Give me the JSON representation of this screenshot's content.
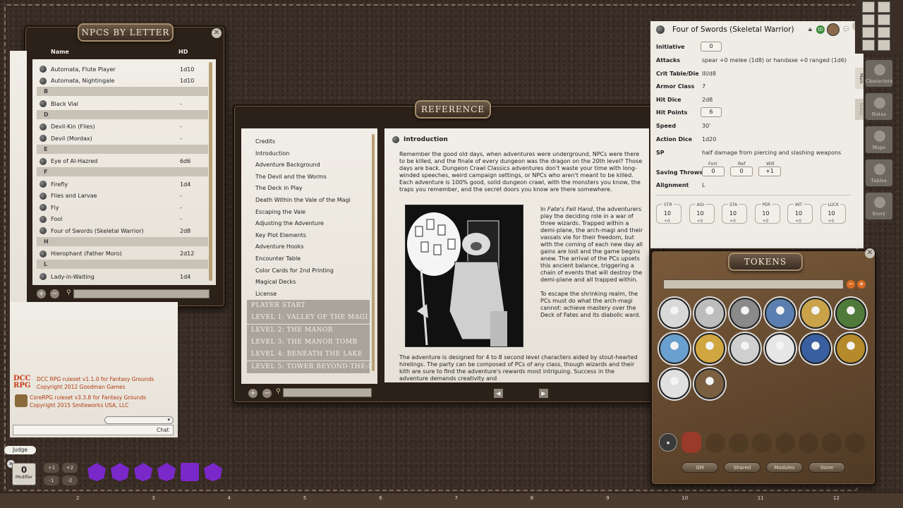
{
  "npc_window": {
    "title": "NPCS BY LETTER",
    "col_name": "Name",
    "col_hd": "HD",
    "rows": [
      {
        "type": "row",
        "name": "Automata, Flute Player",
        "hd": "1d10"
      },
      {
        "type": "row",
        "name": "Automata, Nightingale",
        "hd": "1d10"
      },
      {
        "type": "letter",
        "name": "B"
      },
      {
        "type": "row",
        "name": "Black Vial",
        "hd": "-"
      },
      {
        "type": "letter",
        "name": "D"
      },
      {
        "type": "row",
        "name": "Devil-Kin (Flies)",
        "hd": "-"
      },
      {
        "type": "row",
        "name": "Devil (Mordax)",
        "hd": "-"
      },
      {
        "type": "letter",
        "name": "E"
      },
      {
        "type": "row",
        "name": "Eye of Al-Hazred",
        "hd": "6d6"
      },
      {
        "type": "letter",
        "name": "F"
      },
      {
        "type": "row",
        "name": "Firefly",
        "hd": "1d4"
      },
      {
        "type": "row",
        "name": "Flies and Larvae",
        "hd": "-"
      },
      {
        "type": "row",
        "name": "Fly",
        "hd": "-"
      },
      {
        "type": "row",
        "name": "Fool",
        "hd": "-"
      },
      {
        "type": "row",
        "name": "Four of Swords (Skeletal Warrior)",
        "hd": "2d8"
      },
      {
        "type": "letter",
        "name": "H"
      },
      {
        "type": "row",
        "name": "Hierophant (Father Moro)",
        "hd": "2d12"
      },
      {
        "type": "letter",
        "name": "L"
      },
      {
        "type": "row",
        "name": "Lady-in-Waiting",
        "hd": "1d4"
      }
    ]
  },
  "chat": {
    "ruleset_1a": "DCC RPG ruleset v1.1.0 for Fantasy Grounds",
    "ruleset_1b": "Copyright 2012 Goodman Games",
    "ruleset_2a": "CoreRPG ruleset v3.3.8 for Fantasy Grounds",
    "ruleset_2b": "Copyright 2015 Smiteworks USA, LLC",
    "chat_button": "Chat",
    "identity": "Judge",
    "modifier_value": "0",
    "modifier_label": "Modifier",
    "mod_buttons": [
      "+1",
      "+2",
      "-1",
      "-2"
    ]
  },
  "dice": [
    "d20",
    "d16",
    "d14",
    "d12",
    "d10",
    "d8"
  ],
  "reference": {
    "title": "REFERENCE",
    "toc": [
      "Credits",
      "Introduction",
      "Adventure Background",
      "The Devil and the Worms",
      "The Deck in Play",
      "Death Within the Vale of the Magi",
      "Escaping the Vale",
      "Adjusting the Adventure",
      "Key Plot Elements",
      "Adventure Hooks",
      "Encounter Table",
      "Color Cards for 2nd Printing",
      "Magical Decks",
      "License"
    ],
    "levels": [
      "PLAYER START",
      "LEVEL 1: VALLEY OF THE MAGI",
      "LEVEL 2: THE MANOR",
      "LEVEL 3: THE MANOR TOMB",
      "LEVEL 4: BENEATH THE LAKE",
      "LEVEL 5: TOWER BEYOND-THE-M"
    ],
    "section_title": "Introduction",
    "para1": "Remember the good old days, when adventures were underground, NPCs were there to be killed, and the finale of every dungeon was the dragon on the 20th level? Those days are back. Dungeon Crawl Classics adventures don't waste your time with long-winded speeches, weird campaign settings, or NPCs who aren't meant to be killed. Each adventure is 100% good, solid dungeon crawl, with the monsters you know, the traps you remember, and the secret doors you know are there somewhere.",
    "para2_prefix": "In ",
    "para2_italic": "Fate's Fell Hand",
    "para2_rest": ", the adventurers play the deciding role in a war of three wizards. Trapped within a demi-plane, the arch-magi and their vassals vie for their freedom, but with the coming of each new day all gains are lost and the game begins anew. The arrival of the PCs upsets this ancient balance, triggering a chain of events that will destroy the demi-plane and all trapped within.",
    "para3": "To escape the shrinking realm, the PCs must do what the arch-magi cannot: achieve mastery over the Deck of Fates and its diabolic ward.",
    "para4": "The adventure is designed for 4 to 8 second level characters aided by stout-hearted hirelings. The party can be composed of PCs of any class, though wizards and their kith are sure to find the adventure's rewards most intriguing. Success in the adventure demands creativity and"
  },
  "npc_sheet": {
    "title": "Four of Swords (Skeletal Warrior)",
    "initiative_label": "Initiative",
    "initiative": "0",
    "attacks_label": "Attacks",
    "attacks": "spear +0 melee (1d8) or handaxe +0 ranged (1d6)",
    "crit_label": "Crit Table/Die",
    "crit": "III/d8",
    "ac_label": "Armor Class",
    "ac": "7",
    "hitdice_label": "Hit Dice",
    "hitdice": "2d8",
    "hp_label": "Hit Points",
    "hp": "6",
    "speed_label": "Speed",
    "speed": "30'",
    "action_label": "Action Dice",
    "action": "1d20",
    "sp_label": "SP",
    "sp": "half damage from piercing and slashing weapons",
    "saves_label": "Saving Throws",
    "fort_label": "Fort",
    "fort": "0",
    "ref_label": "Ref",
    "ref": "0",
    "will_label": "Will",
    "will": "+1",
    "align_label": "Alignment",
    "align": "L",
    "tab_main": "Main",
    "tab_notes": "Notes",
    "abilities": [
      {
        "name": "STR",
        "value": "10",
        "mod": "+0"
      },
      {
        "name": "AGI",
        "value": "10",
        "mod": "+0"
      },
      {
        "name": "STA",
        "value": "10",
        "mod": "+0"
      },
      {
        "name": "PER",
        "value": "10",
        "mod": "+0"
      },
      {
        "name": "INT",
        "value": "10",
        "mod": "+0"
      },
      {
        "name": "LUCK",
        "value": "10",
        "mod": "+0"
      }
    ]
  },
  "tokens": {
    "title": "TOKENS",
    "buttons": [
      "GM",
      "Shared",
      "Modules",
      "Store"
    ],
    "colors": [
      "#d8d8d8",
      "#bdbdbd",
      "#8a8a8a",
      "#5a7fb0",
      "#c9a24a",
      "#4f7a3a",
      "#6aa0cf",
      "#d0a640",
      "#cfcfcf",
      "#e6e6e6",
      "#3a5fa0",
      "#b58a2a",
      "#e0e0e0",
      "#7a6040"
    ]
  },
  "sidebar": [
    "Characters",
    "Notes",
    "Maps",
    "Tables",
    "Story"
  ],
  "ruler": [
    "2",
    "3",
    "4",
    "5",
    "6",
    "7",
    "8",
    "9",
    "10",
    "11",
    "12"
  ]
}
